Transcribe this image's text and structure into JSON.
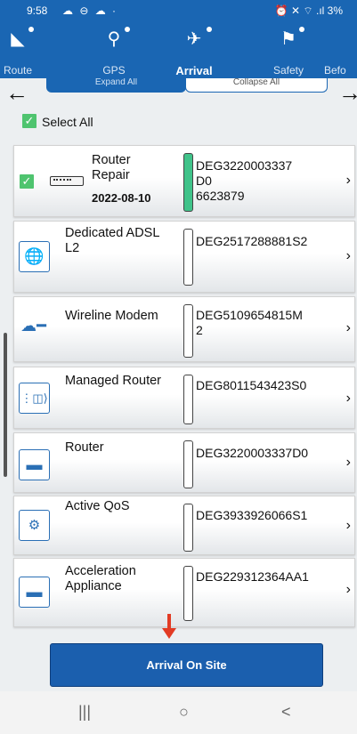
{
  "status_bar": {
    "time": "9:58",
    "status_icons": "☁ ⊖ ☁ ·",
    "right_icons": "⏰ ✕ ⌔ .ıl 3%"
  },
  "tabs": [
    {
      "label": "Route",
      "icon": "route-icon"
    },
    {
      "label": "GPS",
      "icon": "gps-pin-icon"
    },
    {
      "label": "Arrival",
      "icon": "airplane-landing-icon",
      "active": true
    },
    {
      "label": "Safety",
      "icon": "traffic-light-icon"
    },
    {
      "label": "Befo",
      "icon": ""
    }
  ],
  "header": {
    "expand_label": "Expand All",
    "collapse_label": "Collapse All",
    "back_icon": "←",
    "forward_icon": "→"
  },
  "select_all": {
    "label": "Select All",
    "checked": true
  },
  "items": [
    {
      "name": "Router\nRepair",
      "date": "2022-08-10",
      "serial": "DEG3220003337\nD0\n6623879",
      "checked": true,
      "status_color": "#40c38a",
      "icon": "router-device-icon"
    },
    {
      "name": "Dedicated ADSL\nL2",
      "serial": "DEG2517288881S2",
      "icon": "globe-icon"
    },
    {
      "name": "Wireline Modem",
      "serial": "DEG5109654815M\n2",
      "icon": "cloud-modem-icon"
    },
    {
      "name": "Managed Router",
      "serial": "DEG8011543423S0",
      "icon": "managed-router-icon"
    },
    {
      "name": "Router",
      "serial": "DEG3220003337D0",
      "icon": "router-icon"
    },
    {
      "name": "Active QoS",
      "serial": "DEG3933926066S1",
      "icon": "qos-gears-icon"
    },
    {
      "name": "Acceleration\nAppliance",
      "serial": "DEG229312364AA1",
      "icon": "appliance-icon"
    }
  ],
  "primary_button": {
    "label": "Arrival On Site"
  },
  "nav_bar": {
    "recent": "|||",
    "home": "○",
    "back": "<"
  }
}
